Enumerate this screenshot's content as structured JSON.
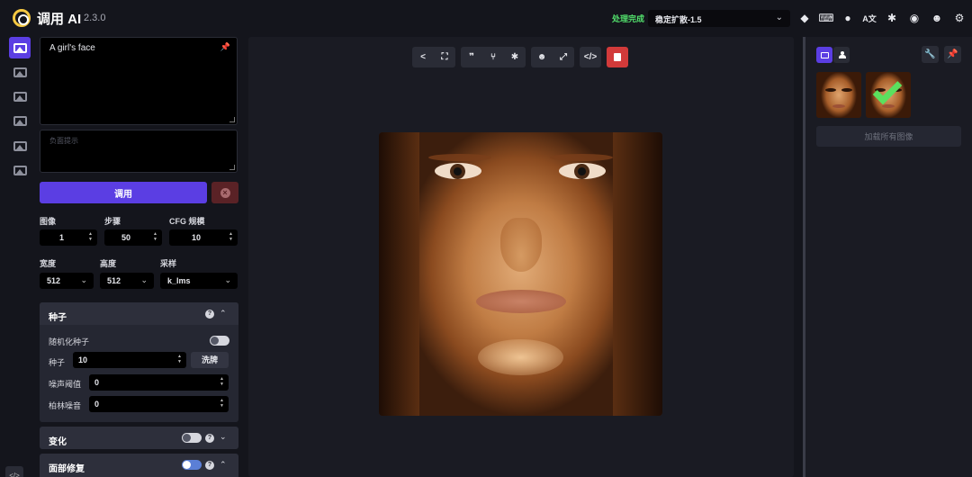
{
  "header": {
    "app_name": "调用 AI",
    "version": "2.3.0",
    "status": "处理完成",
    "model": "稳定扩散-1.5",
    "icons": [
      "cube-icon",
      "keyboard-icon",
      "palette-icon",
      "translate-icon",
      "bug-icon",
      "github-icon",
      "discord-icon",
      "gear-icon"
    ]
  },
  "tabs": [
    "text-to-image-icon",
    "image-to-image-icon",
    "inpainting-icon",
    "outpainting-icon",
    "nodes-icon",
    "postprocess-icon"
  ],
  "prompt": {
    "value": "A girl's face",
    "negative_placeholder": "负面提示"
  },
  "invoke_label": "调用",
  "params": {
    "images_label": "图像",
    "images_value": "1",
    "steps_label": "步骤",
    "steps_value": "50",
    "cfg_label": "CFG 规模",
    "cfg_value": "10",
    "width_label": "宽度",
    "width_value": "512",
    "height_label": "高度",
    "height_value": "512",
    "sampler_label": "采样",
    "sampler_value": "k_lms"
  },
  "seed_section": {
    "title": "种子",
    "random_label": "随机化种子",
    "seed_label": "种子",
    "seed_value": "10",
    "shuffle_label": "洗牌",
    "threshold_label": "噪声阈值",
    "threshold_value": "0",
    "perlin_label": "柏林噪音",
    "perlin_value": "0"
  },
  "variation_title": "变化",
  "face_restore_title": "面部修复",
  "gallery": {
    "load_all_label": "加载所有图像"
  }
}
